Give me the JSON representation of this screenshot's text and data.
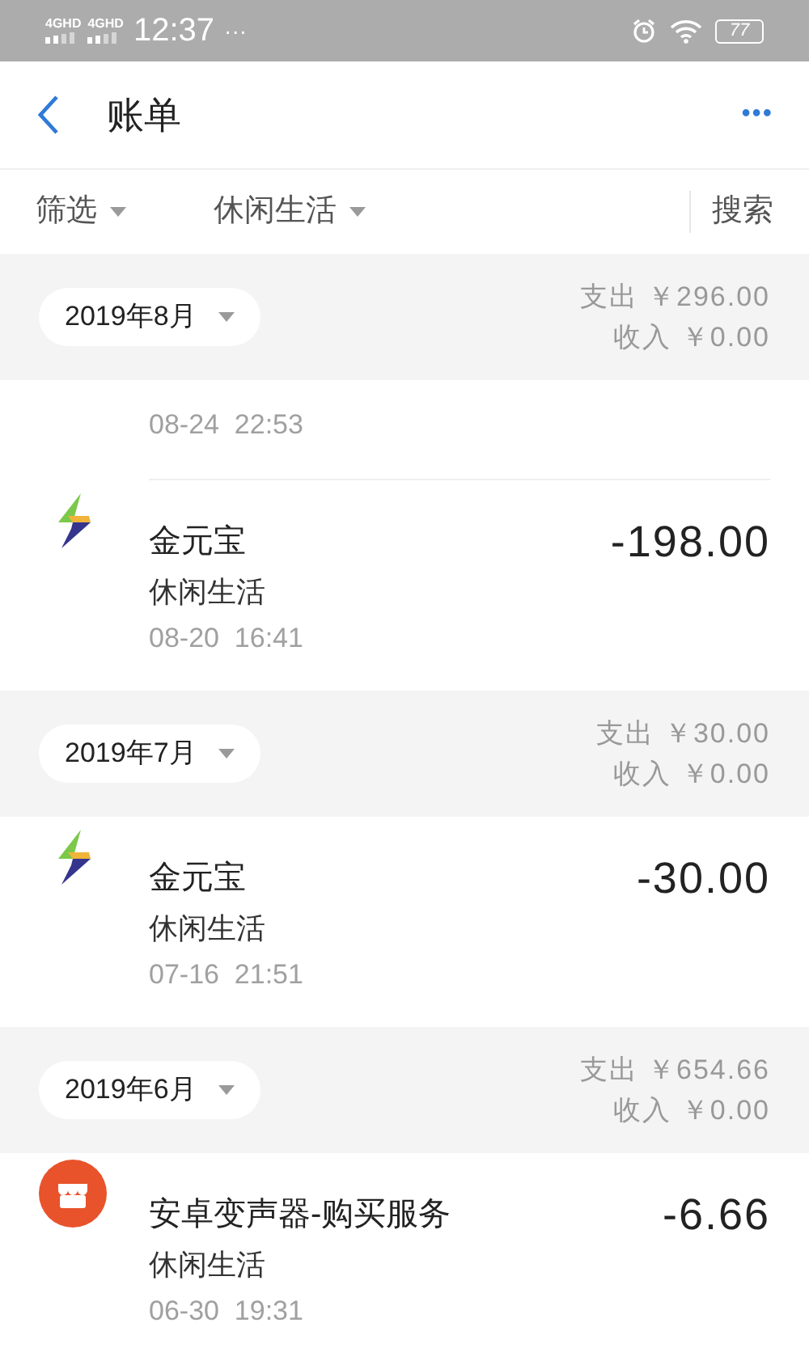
{
  "status_bar": {
    "network_1": "4GHD",
    "network_2": "4GHD",
    "time": "12:37",
    "more": "···",
    "battery": "77"
  },
  "nav": {
    "title": "账单",
    "more": "•••"
  },
  "filters": [
    {
      "label": "筛选"
    },
    {
      "label": "休闲生活"
    }
  ],
  "search": "搜索",
  "months": [
    {
      "month": "2019年8月",
      "expense": "支出 ￥296.00",
      "income": "收入 ￥0.00",
      "partial_row": {
        "time": "08-24  22:53"
      },
      "rows": [
        {
          "kind": "bolt",
          "name": "金元宝",
          "category": "休闲生活",
          "time": "08-20  16:41",
          "amount": "-198.00"
        }
      ]
    },
    {
      "month": "2019年7月",
      "expense": "支出 ￥30.00",
      "income": "收入 ￥0.00",
      "rows": [
        {
          "kind": "bolt",
          "name": "金元宝",
          "category": "休闲生活",
          "time": "07-16  21:51",
          "amount": "-30.00"
        }
      ]
    },
    {
      "month": "2019年6月",
      "expense": "支出 ￥654.66",
      "income": "收入 ￥0.00",
      "rows": [
        {
          "kind": "shop",
          "name": "安卓变声器-购买服务",
          "category": "休闲生活",
          "time": "06-30  19:31",
          "amount": "-6.66"
        }
      ]
    }
  ]
}
